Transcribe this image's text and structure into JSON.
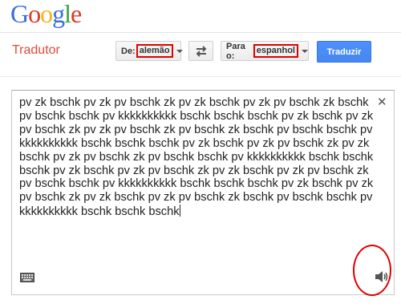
{
  "logo": "Google",
  "app_title": "Tradutor",
  "from_select": {
    "prefix": "De:",
    "value": "alemão"
  },
  "to_select": {
    "prefix": "Para o:",
    "value": "espanhol"
  },
  "translate_button": "Traduzir",
  "source_text": "pv zk bschk pv zk pv bschk zk pv zk bschk pv zk pv bschk zk bschk pv bschk bschk pv kkkkkkkkkk bschk bschk bschk pv zk bschk pv zk pv bschk zk pv zk pv bschk zk pv bschk zk bschk pv bschk bschk pv kkkkkkkkkk bschk bschk bschk pv zk bschk pv zk pv bschk zk pv zk bschk pv zk pv bschk zk pv bschk bschk pv kkkkkkkkkk bschk bschk bschk pv zk bschk pv zk pv bschk zk pv zk bschk pv zk pv bschk zk pv bschk bschk pv kkkkkkkkkk bschk bschk bschk pv zk bschk pv zk pv bschk zk pv zk bschk pv zk pv bschk zk bschk pv bschk bschk pv kkkkkkkkkk bschk bschk bschk",
  "icons": {
    "swap": "swap-arrows-icon",
    "close": "close-icon",
    "keyboard": "keyboard-icon",
    "speaker": "speaker-icon"
  },
  "colors": {
    "accent": "#4d90fe",
    "title": "#dd4b39",
    "highlight": "#e00000"
  }
}
